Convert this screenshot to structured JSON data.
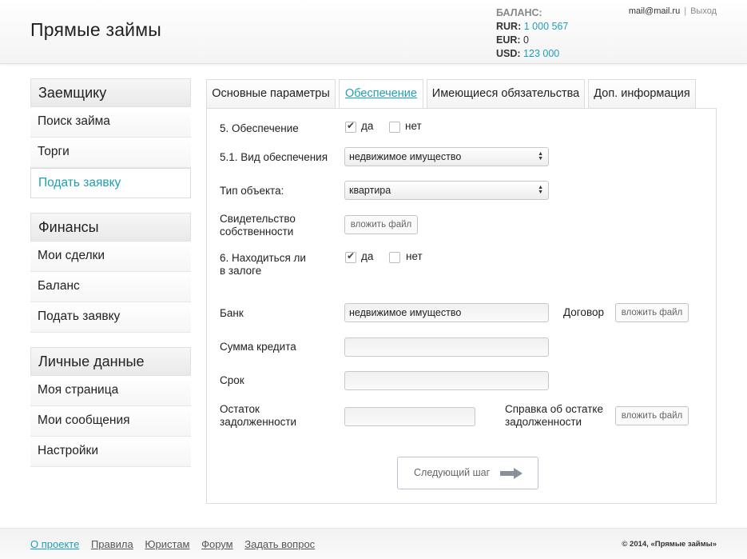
{
  "header": {
    "logo": "Прямые займы",
    "balance_title": "БАЛАНС:",
    "balances": [
      {
        "currency": "RUR:",
        "amount": "1 000 567",
        "accent": true
      },
      {
        "currency": "EUR:",
        "amount": "0",
        "accent": false
      },
      {
        "currency": "USD:",
        "amount": "123 000",
        "accent": true
      }
    ],
    "user_email": "mail@mail.ru",
    "separator": "|",
    "logout": "Выход"
  },
  "sidebar": {
    "groups": [
      {
        "title": "Заемщику",
        "items": [
          "Поиск займа",
          "Торги",
          "Подать заявку"
        ]
      },
      {
        "title": "Финансы",
        "items": [
          "Мои сделки",
          "Баланс",
          "Подать заявку"
        ]
      },
      {
        "title": "Личные данные",
        "items": [
          "Моя страница",
          "Мои сообщения",
          "Настройки"
        ]
      }
    ]
  },
  "tabs": [
    "Основные параметры",
    "Обеспечение",
    "Имеющиеся обязательства",
    "Доп. информация"
  ],
  "form": {
    "security_label": "5. Обеспечение",
    "yes": "да",
    "no": "нет",
    "security_type_label": "5.1. Вид обеспечения",
    "security_type_value": "недвижимое имущество",
    "object_type_label": "Тип объекта:",
    "object_type_value": "квартира",
    "certificate_label_1": "Свидетельство",
    "certificate_label_2": "собственности",
    "attach_file": "вложить файл",
    "pledge_label_1": "6. Находиться ли",
    "pledge_label_2": "в залоге",
    "bank_label": "Банк",
    "bank_value": "недвижимое имущество",
    "contract_label": "Договор",
    "credit_sum_label": "Сумма кредита",
    "term_label": "Срок",
    "debt_label_1": "Остаток",
    "debt_label_2": "задолженности",
    "debt_cert_label_1": "Справка об остатке",
    "debt_cert_label_2": "задолженности",
    "next_button": "Следующий шаг"
  },
  "footer": {
    "links": [
      "О проекте",
      "Правила",
      "Юристам",
      "Форум",
      "Задать вопрос"
    ],
    "copyright": "© 2014, «Прямые займы»"
  }
}
